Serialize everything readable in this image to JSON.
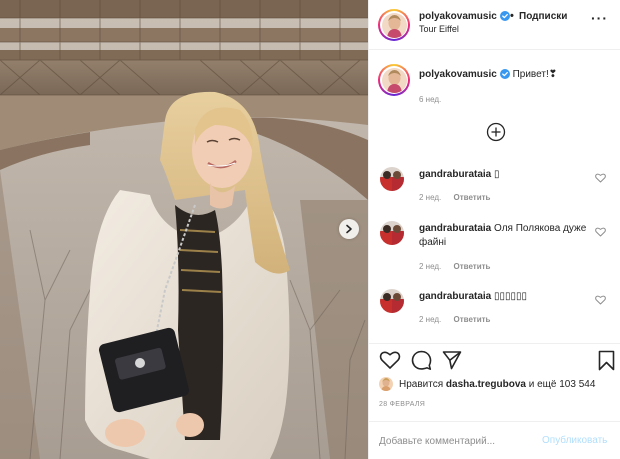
{
  "post": {
    "author": "polyakovamusic",
    "follow_label": "Подписки",
    "separator": "•",
    "location": "Tour Eiffel",
    "more_label": "···",
    "caption": {
      "username": "polyakovamusic",
      "text": "Привет!❣",
      "time": "6 нед."
    }
  },
  "comments": [
    {
      "username": "gandraburataia",
      "text": "▯",
      "time": "2 нед.",
      "reply_label": "Ответить"
    },
    {
      "username": "gandraburataia",
      "text": "Оля Полякова дуже файні",
      "time": "2 нед.",
      "reply_label": "Ответить"
    },
    {
      "username": "gandraburataia",
      "text": "▯▯▯▯▯▯",
      "time": "2 нед.",
      "reply_label": "Ответить"
    }
  ],
  "likes": {
    "prefix": "Нравится",
    "username": "dasha.tregubova",
    "suffix": "и ещё 103 544"
  },
  "date": "28 ФЕВРАЛЯ",
  "add_comment": {
    "placeholder": "Добавьте комментарий...",
    "publish_label": "Опубликовать"
  },
  "icons": {
    "verified": "verified-badge-icon",
    "like": "heart-icon",
    "comment": "comment-icon",
    "share": "paper-plane-icon",
    "save": "bookmark-icon",
    "load_more": "plus-circle-icon",
    "next": "chevron-right-icon"
  },
  "colors": {
    "verified": "#3897f0",
    "publish_disabled": "#b2dffc",
    "secondary_text": "#8e8e8e"
  }
}
